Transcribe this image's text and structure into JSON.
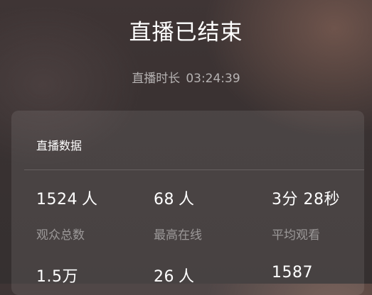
{
  "header": {
    "title": "直播已结束",
    "duration_label": "直播时长",
    "duration_value": "03:24:39"
  },
  "card": {
    "title": "直播数据",
    "stats_row1": [
      {
        "value": "1524",
        "unit": "人",
        "label": "观众总数"
      },
      {
        "value": "68",
        "unit": "人",
        "label": "最高在线"
      },
      {
        "value": "3分 28秒",
        "unit": "",
        "label": "平均观看"
      }
    ],
    "stats_row2": [
      {
        "value": "1.5万",
        "unit": ""
      },
      {
        "value": "26",
        "unit": "人"
      },
      {
        "value": "1587",
        "unit": ""
      }
    ]
  }
}
